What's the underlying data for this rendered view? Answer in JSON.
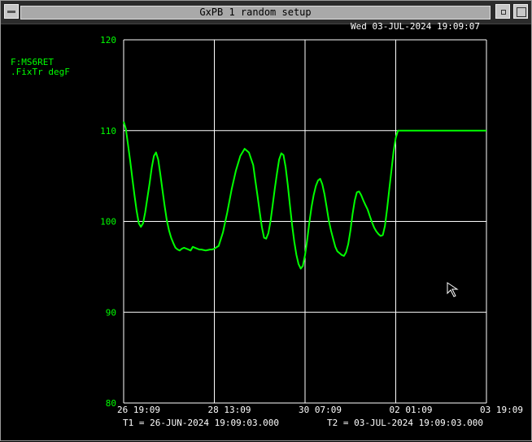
{
  "window": {
    "title": "GxPB 1 random setup"
  },
  "timestamp": "Wed 03-JUL-2024 19:09:07",
  "signal": {
    "name": "F:MS6RET",
    "units": ".FixTr  degF"
  },
  "footer": {
    "t1": "T1 = 26-JUN-2024 19:09:03.000",
    "t2": "T2 = 03-JUL-2024 19:09:03.000"
  },
  "colors": {
    "trace": "#00ff00",
    "axis_text": "#00ff00",
    "grid": "#ffffff",
    "background": "#000000"
  },
  "chart_data": {
    "type": "line",
    "title": "",
    "ylim": [
      80,
      120
    ],
    "yticks": [
      120,
      110,
      100,
      90,
      80
    ],
    "xticks": [
      "26 19:09",
      "28 13:09",
      "30 07:09",
      "02 01:09",
      "03 19:09"
    ],
    "xlim_hours": [
      0,
      168
    ],
    "grid": true,
    "series": [
      {
        "x_hours": [
          0,
          1,
          2,
          3,
          4,
          5,
          6,
          7,
          8,
          9,
          10,
          11,
          12,
          13,
          14,
          15,
          16,
          17,
          18,
          19,
          20,
          21,
          22,
          23,
          24,
          25,
          26,
          27,
          28,
          29,
          30,
          31,
          32,
          33,
          34,
          35,
          36,
          38,
          40,
          41,
          42,
          44,
          46,
          48,
          50,
          52,
          54,
          56,
          58,
          60,
          61,
          62,
          63,
          64,
          65,
          66,
          67,
          68,
          69,
          70,
          71,
          72,
          73,
          74,
          75,
          76,
          77,
          78,
          79,
          80,
          81,
          82,
          83,
          84,
          85,
          86,
          87,
          88,
          89,
          90,
          91,
          92,
          93,
          94,
          95,
          96,
          97,
          98,
          99,
          100,
          101,
          102,
          103,
          104,
          105,
          106,
          107,
          108,
          109,
          110,
          111,
          112,
          113,
          114,
          115,
          116,
          117,
          118,
          119,
          120,
          121,
          122,
          123,
          124,
          125,
          126,
          127,
          128,
          129,
          130,
          131,
          132,
          133,
          134,
          135,
          136,
          137,
          138,
          139,
          140,
          141,
          142,
          143,
          144,
          145,
          146,
          147,
          148,
          149,
          150,
          151,
          152,
          153,
          154,
          155,
          156,
          157,
          158,
          159,
          160,
          161,
          162,
          163,
          164,
          165,
          166,
          167,
          168
        ],
        "values": [
          111.0,
          110.2,
          108.5,
          106.7,
          104.8,
          102.9,
          101.2,
          99.8,
          99.4,
          99.8,
          101.0,
          102.6,
          104.2,
          105.9,
          107.2,
          107.6,
          106.8,
          105.2,
          103.4,
          101.7,
          100.1,
          99.0,
          98.2,
          97.6,
          97.1,
          96.9,
          96.8,
          97.0,
          97.1,
          97.0,
          96.9,
          96.8,
          97.2,
          97.1,
          97.0,
          96.9,
          96.9,
          96.8,
          96.9,
          96.9,
          97.0,
          97.3,
          98.8,
          101.0,
          103.5,
          105.6,
          107.2,
          108.0,
          107.6,
          106.2,
          104.5,
          102.8,
          101.0,
          99.4,
          98.2,
          98.1,
          98.7,
          100.0,
          101.8,
          103.6,
          105.3,
          106.8,
          107.5,
          107.3,
          106.0,
          104.0,
          101.8,
          99.6,
          97.8,
          96.3,
          95.3,
          94.8,
          95.1,
          96.3,
          98.0,
          99.9,
          101.6,
          102.9,
          103.9,
          104.5,
          104.7,
          104.1,
          103.0,
          101.6,
          100.1,
          99.0,
          98.1,
          97.2,
          96.7,
          96.5,
          96.3,
          96.2,
          96.6,
          97.5,
          99.0,
          100.8,
          102.3,
          103.2,
          103.3,
          102.9,
          102.3,
          101.8,
          101.3,
          100.6,
          99.9,
          99.3,
          98.9,
          98.6,
          98.4,
          98.5,
          99.5,
          101.4,
          103.5,
          105.6,
          107.7,
          109.2,
          110.0,
          110.0,
          110.0,
          110.0,
          110.0,
          110.0,
          110.0,
          110.0,
          110.0,
          110.0,
          110.0,
          110.0,
          110.0,
          110.0,
          110.0,
          110.0,
          110.0,
          110.0,
          110.0,
          110.0,
          110.0,
          110.0,
          110.0,
          110.0,
          110.0,
          110.0,
          110.0,
          110.0,
          110.0,
          110.0,
          110.0,
          110.0,
          110.0,
          110.0,
          110.0,
          110.0,
          110.0,
          110.0,
          110.0,
          110.0,
          110.0,
          110.0,
          110.0,
          110.0
        ]
      }
    ]
  }
}
